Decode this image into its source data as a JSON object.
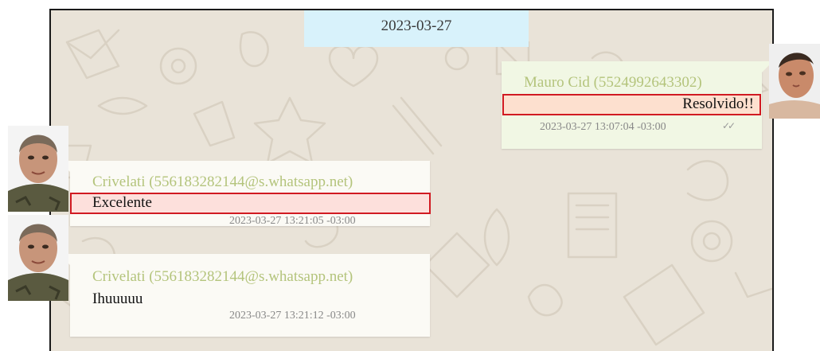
{
  "date_banner": "2023-03-27",
  "messages": [
    {
      "direction": "outgoing",
      "sender": "Mauro Cid (5524992643302)",
      "text": "Resolvido!!",
      "timestamp": "2023-03-27 13:07:04 -03:00",
      "status_icon": "double-check-icon",
      "highlighted": true
    },
    {
      "direction": "incoming",
      "sender": "Crivelati (556183282144@s.whatsapp.net)",
      "text": "Excelente",
      "timestamp": "2023-03-27 13:21:05 -03:00",
      "highlighted": true
    },
    {
      "direction": "incoming",
      "sender": "Crivelati (556183282144@s.whatsapp.net)",
      "text": "Ihuuuuu",
      "timestamp": "2023-03-27 13:21:12 -03:00",
      "highlighted": false
    }
  ],
  "colors": {
    "chat_background": "#e9e3d8",
    "date_banner": "#d8f2fb",
    "outgoing_bubble": "#f1f7e4",
    "incoming_bubble": "#fbfaf5",
    "sender_name": "#b4c47c",
    "highlight_outline": "#d11a22",
    "highlight_fill_out": "#fde0cf",
    "highlight_fill_in": "#fde0dc"
  }
}
